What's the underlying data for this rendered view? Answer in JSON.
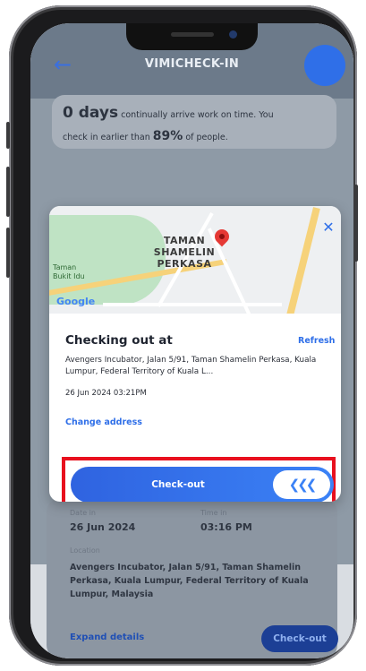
{
  "app": {
    "title": "VIMICHECK-IN",
    "back_icon": "back-arrow-icon"
  },
  "streak": {
    "days": "0 days",
    "text1": "continually arrive work on time. You",
    "text2": "check in earlier than",
    "percent": "89%",
    "text3": "of people."
  },
  "details": {
    "date_label": "Date in",
    "date_value": "26 Jun 2024",
    "time_label": "Time in",
    "time_value": "03:16 PM",
    "location_label": "Location",
    "location_value": "Avengers Incubator, Jalan 5/91, Taman Shamelin Perkasa, Kuala Lumpur, Federal Territory of Kuala Lumpur, Malaysia",
    "expand_link": "Expand details",
    "checkout_button": "Check-out"
  },
  "modal": {
    "map": {
      "area_label_line1": "TAMAN",
      "area_label_line2": "SHAMELIN",
      "area_label_line3": "PERKASA",
      "small_label_line1": "Taman",
      "small_label_line2": "Bukit Idu",
      "google_logo": "Google"
    },
    "title": "Checking out at",
    "refresh": "Refresh",
    "address": "Avengers Incubator, Jalan 5/91, Taman Shamelin Perkasa, Kuala Lumpur, Federal Territory of Kuala L...",
    "datetime": "26 Jun 2024 03:21PM",
    "change_address": "Change address",
    "slider_label": "Check-out",
    "slider_icon": "chevrons-left-icon",
    "close_icon": "close-icon"
  },
  "colors": {
    "accent": "#2f6fe8",
    "highlight": "#e8101e"
  }
}
